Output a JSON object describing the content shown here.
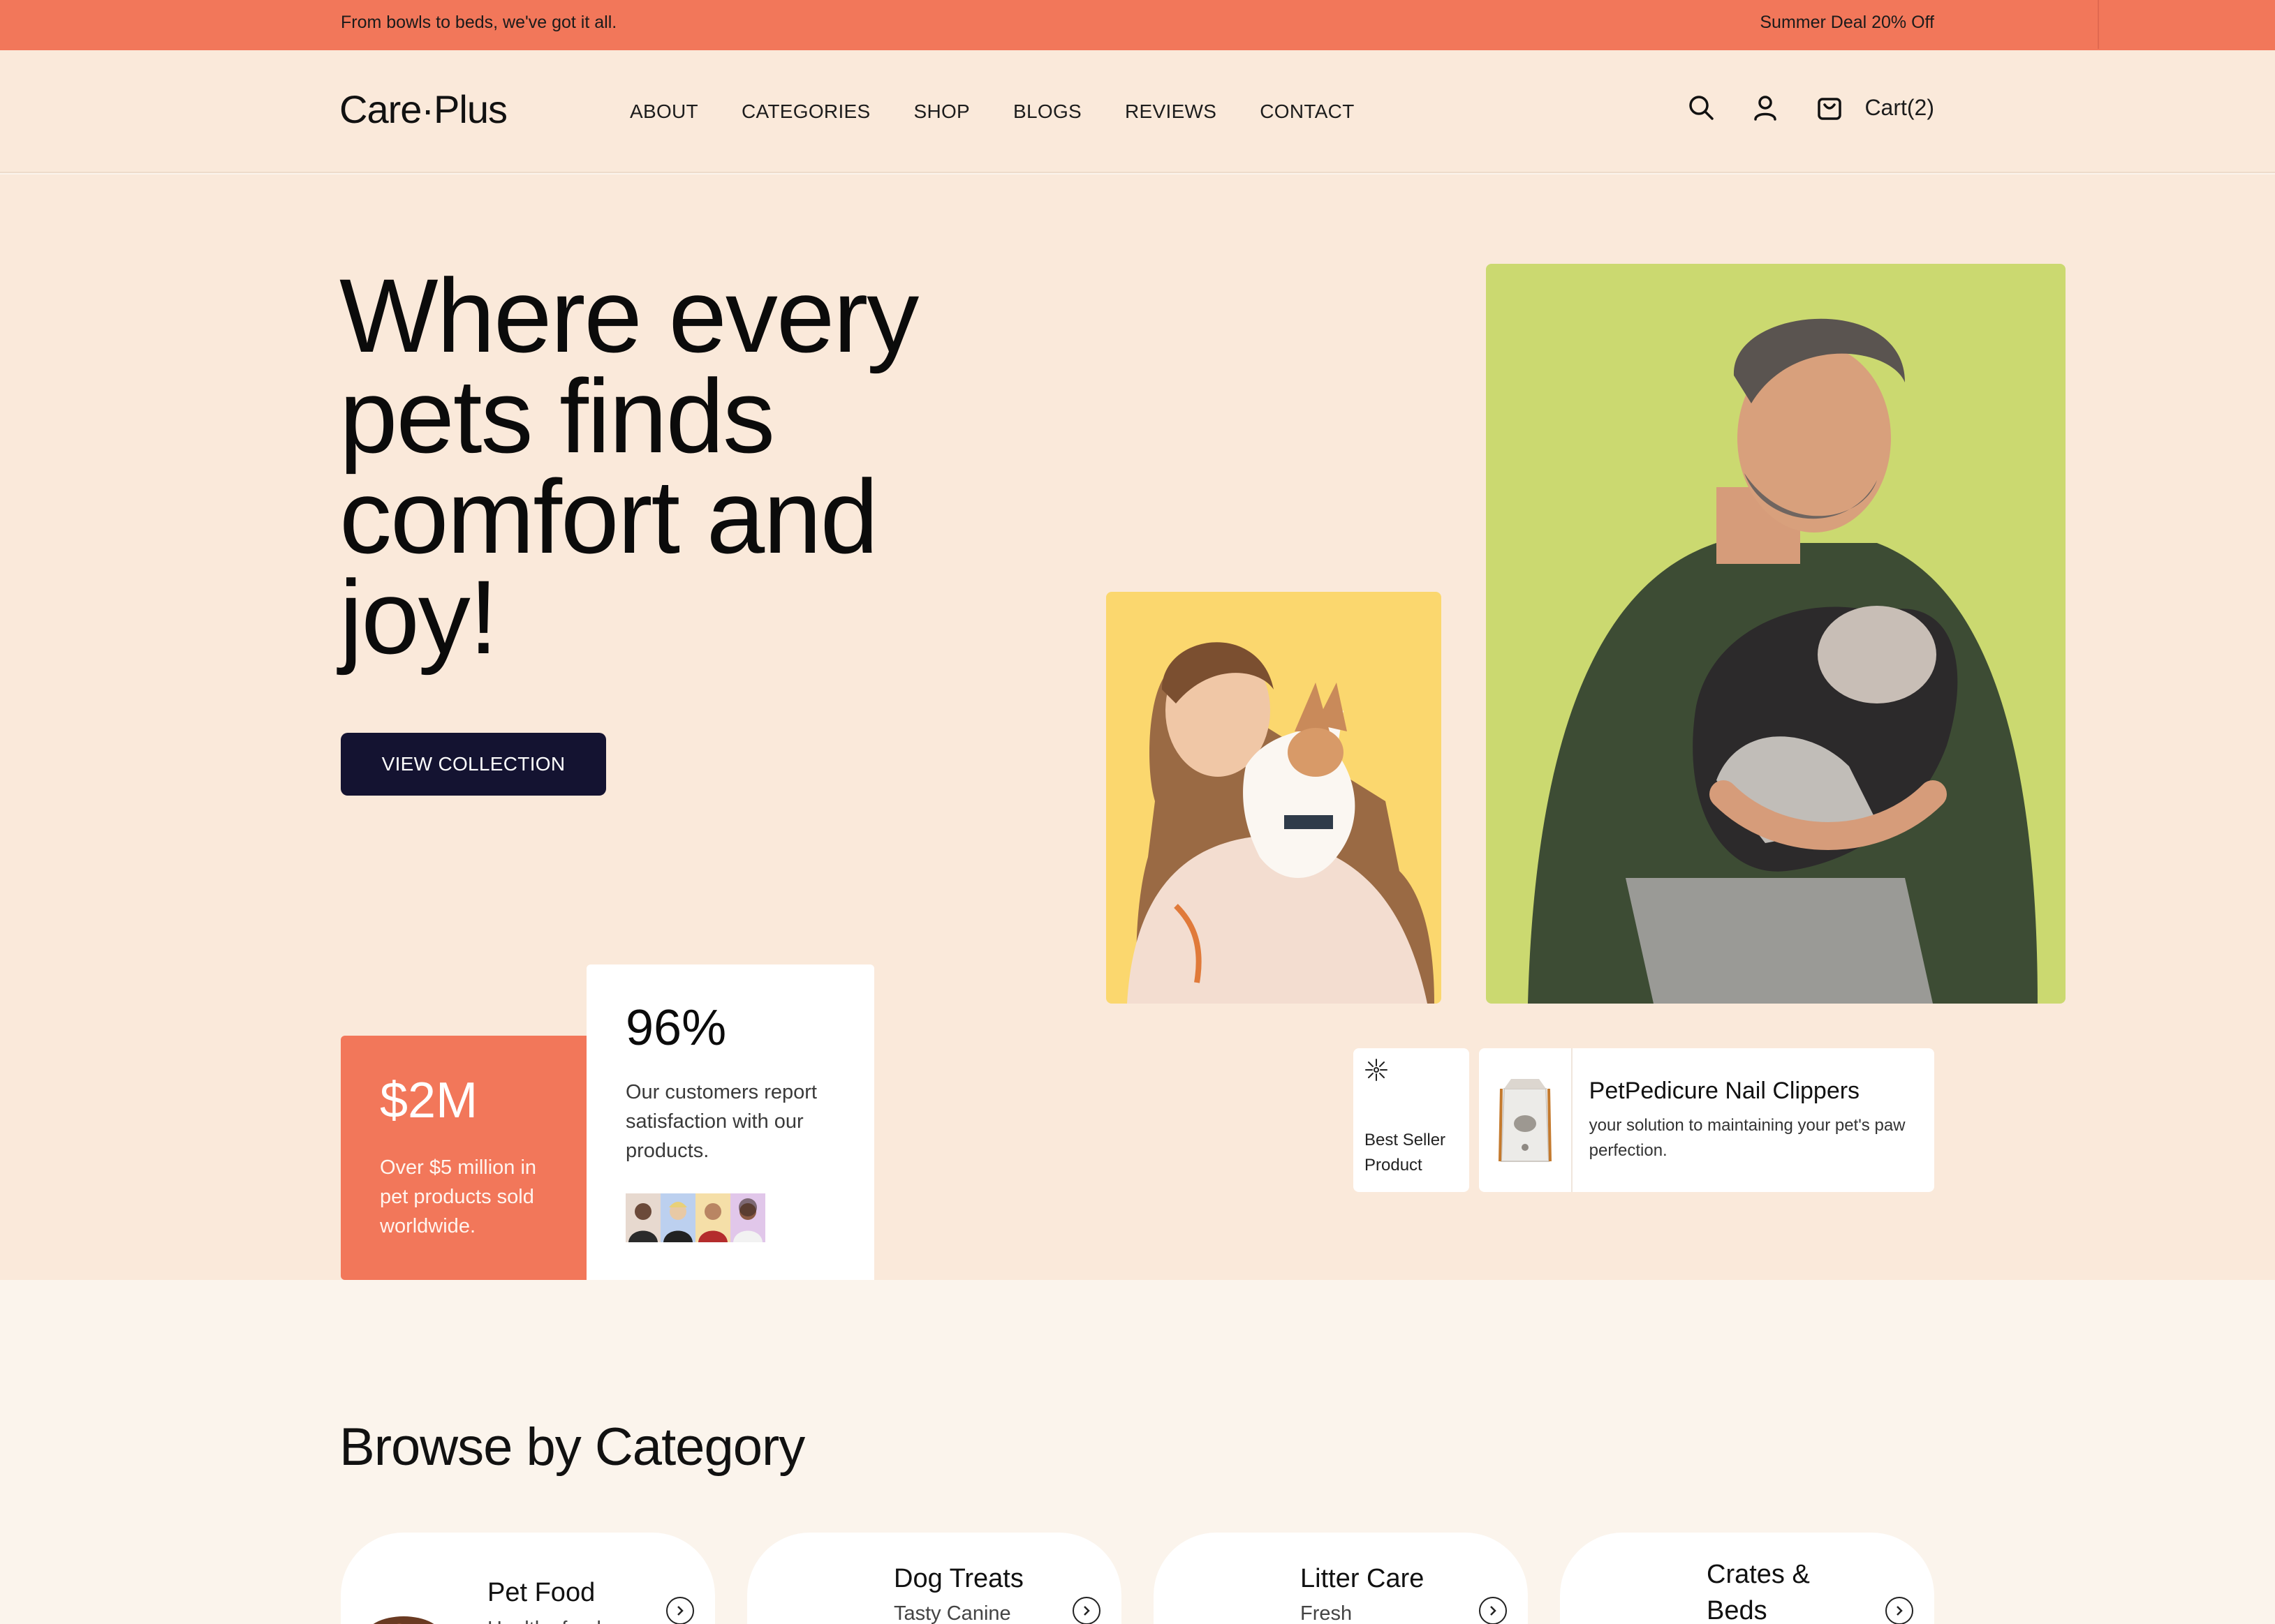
{
  "promo": {
    "left_text": "From bowls to beds, we've got it all.",
    "right_text": "Summer Deal 20% Off"
  },
  "header": {
    "logo": "Care·Plus",
    "nav": [
      "ABOUT",
      "CATEGORIES",
      "SHOP",
      "BLOGS",
      "REVIEWS",
      "CONTACT"
    ],
    "icons": [
      "search-icon",
      "user-icon",
      "cart-bag-icon"
    ],
    "cart_label": "Cart(2)"
  },
  "hero": {
    "title": "Where every pets finds comfort and joy!",
    "cta": "VIEW COLLECTION",
    "stat_revenue": {
      "value": "$2M",
      "desc": "Over $5 million in pet products sold worldwide."
    },
    "stat_satisfaction": {
      "value": "96%",
      "desc": "Our customers report satisfaction with our products."
    },
    "best_seller_label": "Best Seller Product",
    "product": {
      "name": "PetPedicure Nail Clippers",
      "desc": "your solution to maintaining your pet's paw perfection."
    }
  },
  "categories": {
    "title": "Browse by Category",
    "items": [
      {
        "name": "Pet Food",
        "sub": "Healthy food"
      },
      {
        "name": "Dog Treats",
        "sub": "Tasty Canine"
      },
      {
        "name": "Litter Care",
        "sub": "Fresh"
      },
      {
        "name": "Crates & Beds",
        "sub": ""
      }
    ]
  },
  "colors": {
    "accent": "#f2775a",
    "background": "#fae9da",
    "cta": "#141331",
    "yellow_card": "#fbd76e",
    "green_card": "#cbd970"
  }
}
